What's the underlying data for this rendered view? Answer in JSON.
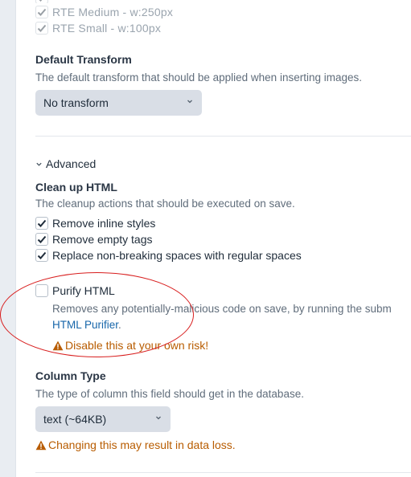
{
  "transforms": {
    "items": [
      {
        "label": "RTE Medium - w:250px",
        "checked": true
      },
      {
        "label": "RTE Small - w:100px",
        "checked": true
      }
    ]
  },
  "default_transform": {
    "heading": "Default Transform",
    "instructions": "The default transform that should be applied when inserting images.",
    "selected": "No transform"
  },
  "advanced": {
    "toggle_label": "Advanced"
  },
  "cleanup": {
    "heading": "Clean up HTML",
    "instructions": "The cleanup actions that should be executed on save.",
    "items": [
      {
        "label": "Remove inline styles",
        "checked": true
      },
      {
        "label": "Remove empty tags",
        "checked": true
      },
      {
        "label": "Replace non-breaking spaces with regular spaces",
        "checked": true
      }
    ]
  },
  "purify": {
    "label": "Purify HTML",
    "checked": false,
    "description": "Removes any potentially-malicious code on save, by running the subm",
    "link_text": "HTML Purifier",
    "link_suffix": ".",
    "warning": "Disable this at your own risk!"
  },
  "column_type": {
    "heading": "Column Type",
    "instructions": "The type of column this field should get in the database.",
    "selected": "text (~64KB)",
    "warning": "Changing this may result in data loss."
  },
  "colors": {
    "warning": "#b85c00",
    "link": "#1766aa",
    "annotation": "#d81e1e"
  }
}
